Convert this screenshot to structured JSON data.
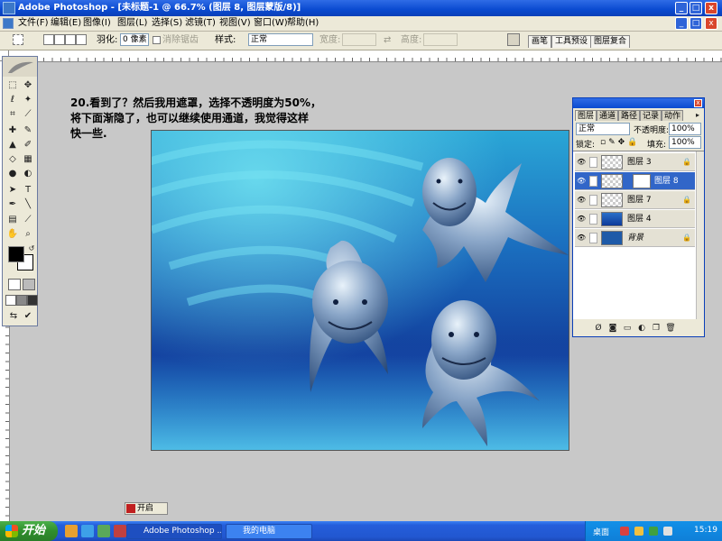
{
  "app": {
    "title": "Adobe Photoshop - [未标题-1 @ 66.7% (图层 8, 图层蒙版/8)]",
    "window_controls": [
      "_",
      "□",
      "x"
    ]
  },
  "menu": [
    "文件(F)",
    "编辑(E)",
    "图像(I)",
    "图层(L)",
    "选择(S)",
    "滤镜(T)",
    "视图(V)",
    "窗口(W)",
    "帮助(H)"
  ],
  "options": {
    "feather_label": "羽化:",
    "feather_value": "0 像素",
    "antialias_label": "消除锯齿",
    "style_label": "样式:",
    "style_value": "正常",
    "width_label": "宽度:",
    "height_label": "高度:",
    "palette_tabs": [
      "画笔",
      "工具预设",
      "图层复合"
    ]
  },
  "caption": {
    "lines": [
      "20.看到了？然后我用遮罩，选择不透明度为50%，",
      "将下面渐隐了，也可以继续使用通道，我觉得这样",
      "快一些."
    ]
  },
  "layers_panel": {
    "tabs": [
      "图层",
      "通道",
      "路径",
      "记录",
      "动作"
    ],
    "blend_mode": "正常",
    "opacity_label": "不透明度:",
    "opacity_value": "100%",
    "lock_label": "锁定:",
    "fill_label": "填充:",
    "fill_value": "100%",
    "layers": [
      {
        "name": "图层 3",
        "selected": false
      },
      {
        "name": "图层 8",
        "selected": true
      },
      {
        "name": "图层 7",
        "selected": false
      },
      {
        "name": "图层 4",
        "selected": false
      },
      {
        "name": "背景",
        "selected": false
      }
    ]
  },
  "mini_window": {
    "label": "开启"
  },
  "taskbar": {
    "start_label": "开始",
    "items": [
      "Adobe Photoshop ...",
      "我的电脑"
    ],
    "tray_text": "桌面",
    "clock": "15:19"
  },
  "colors": {
    "title_blue": "#0a4ad0",
    "selected_layer": "#3166c8",
    "xp_green": "#2f8e2d",
    "ocean_deep": "#0e3a9a",
    "ocean_light": "#36c6e8"
  }
}
